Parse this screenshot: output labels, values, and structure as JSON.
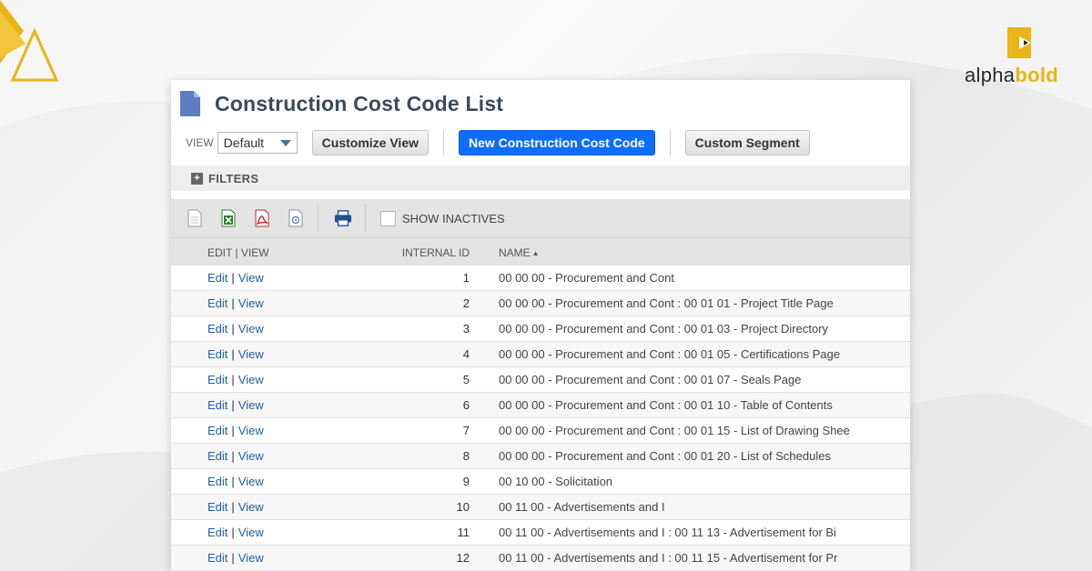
{
  "brand": {
    "word1": "alpha",
    "word2": "bold",
    "accent_color": "#e8b515"
  },
  "page": {
    "title": "Construction Cost Code List"
  },
  "toolbar": {
    "view_label": "VIEW",
    "view_value": "Default",
    "customize_view": "Customize View",
    "new_code": "New Construction Cost Code",
    "custom_segment": "Custom Segment"
  },
  "filters": {
    "label": "FILTERS"
  },
  "list_actions": {
    "icons": [
      "export-csv-icon",
      "export-excel-icon",
      "export-pdf-icon",
      "export-xml-icon",
      "print-icon"
    ],
    "show_inactives": "SHOW INACTIVES"
  },
  "table": {
    "headers": {
      "edit_view": "EDIT | VIEW",
      "internal_id": "INTERNAL ID",
      "name": "NAME"
    },
    "rows": [
      {
        "edit": "Edit",
        "view": "View",
        "id": "1",
        "name": "00 00 00 - Procurement and Cont"
      },
      {
        "edit": "Edit",
        "view": "View",
        "id": "2",
        "name": "00 00 00 - Procurement and Cont : 00 01 01 - Project Title Page"
      },
      {
        "edit": "Edit",
        "view": "View",
        "id": "3",
        "name": "00 00 00 - Procurement and Cont : 00 01 03 - Project Directory"
      },
      {
        "edit": "Edit",
        "view": "View",
        "id": "4",
        "name": "00 00 00 - Procurement and Cont : 00 01 05 - Certifications Page"
      },
      {
        "edit": "Edit",
        "view": "View",
        "id": "5",
        "name": "00 00 00 - Procurement and Cont : 00 01 07 - Seals Page"
      },
      {
        "edit": "Edit",
        "view": "View",
        "id": "6",
        "name": "00 00 00 - Procurement and Cont : 00 01 10 - Table of Contents"
      },
      {
        "edit": "Edit",
        "view": "View",
        "id": "7",
        "name": "00 00 00 - Procurement and Cont : 00 01 15 - List of Drawing Shee"
      },
      {
        "edit": "Edit",
        "view": "View",
        "id": "8",
        "name": "00 00 00 - Procurement and Cont : 00 01 20 - List of Schedules"
      },
      {
        "edit": "Edit",
        "view": "View",
        "id": "9",
        "name": "00 10 00 - Solicitation"
      },
      {
        "edit": "Edit",
        "view": "View",
        "id": "10",
        "name": "00 11 00 - Advertisements and I"
      },
      {
        "edit": "Edit",
        "view": "View",
        "id": "11",
        "name": "00 11 00 - Advertisements and I : 00 11 13 - Advertisement for Bi"
      },
      {
        "edit": "Edit",
        "view": "View",
        "id": "12",
        "name": "00 11 00 - Advertisements and I : 00 11 15 - Advertisement for Pr"
      }
    ]
  }
}
